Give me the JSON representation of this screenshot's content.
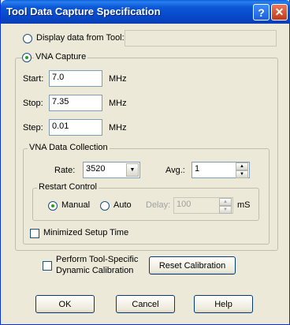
{
  "window": {
    "title": "Tool Data Capture Specification",
    "help_glyph": "?",
    "close_glyph": "✕"
  },
  "source": {
    "display_from_tool_label": "Display data from Tool:",
    "display_from_tool_value": "",
    "display_from_tool_selected": false,
    "vna_capture_label": "VNA Capture",
    "vna_capture_selected": true
  },
  "vna_capture": {
    "start_label": "Start:",
    "start_value": "7.0",
    "start_unit": "MHz",
    "stop_label": "Stop:",
    "stop_value": "7.35",
    "stop_unit": "MHz",
    "step_label": "Step:",
    "step_value": "0.01",
    "step_unit": "MHz"
  },
  "data_collection": {
    "title": "VNA Data Collection",
    "rate_label": "Rate:",
    "rate_value": "3520",
    "avg_label": "Avg.:",
    "avg_value": "1",
    "restart": {
      "title": "Restart Control",
      "manual_label": "Manual",
      "manual_selected": true,
      "auto_label": "Auto",
      "auto_selected": false,
      "delay_label": "Delay:",
      "delay_value": "100",
      "delay_unit": "mS"
    },
    "minimized_setup_label": "Minimized Setup Time",
    "minimized_setup_checked": false
  },
  "calibration": {
    "perform_label_line1": "Perform Tool-Specific",
    "perform_label_line2": "Dynamic Calibration",
    "perform_checked": false,
    "reset_button": "Reset Calibration"
  },
  "buttons": {
    "ok": "OK",
    "cancel": "Cancel",
    "help": "Help"
  },
  "colors": {
    "titlebar": "#0748c9",
    "dialog_bg": "#ece9d8",
    "close_button": "#c13a1c",
    "radio_dot": "#21a121"
  }
}
